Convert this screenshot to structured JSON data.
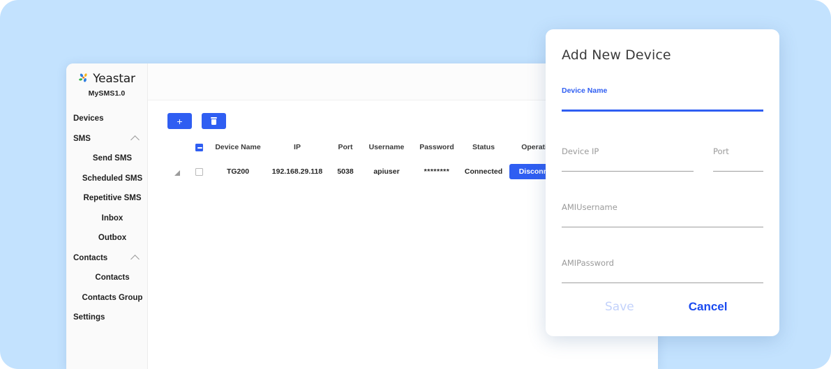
{
  "theme": {
    "page_background": "#c3e2fe",
    "accent_blue": "#2f5ef2",
    "link_blue": "#1a4af0",
    "status_green": "#16a34a",
    "disabled_blue": "#c3d2fb"
  },
  "sidebar": {
    "brand_name": "Yeastar",
    "brand_sub": "MySMS1.0",
    "logo_icon": "yeastar-flower-logo",
    "items": [
      {
        "label": "Devices",
        "type": "item"
      },
      {
        "label": "SMS",
        "type": "group",
        "icon": "chevron-up-icon"
      },
      {
        "label": "Send SMS",
        "type": "sub"
      },
      {
        "label": "Scheduled SMS",
        "type": "sub"
      },
      {
        "label": "Repetitive SMS",
        "type": "sub"
      },
      {
        "label": "Inbox",
        "type": "sub"
      },
      {
        "label": "Outbox",
        "type": "sub"
      },
      {
        "label": "Contacts",
        "type": "group",
        "icon": "chevron-up-icon"
      },
      {
        "label": "Contacts",
        "type": "sub"
      },
      {
        "label": "Contacts Group",
        "type": "sub"
      },
      {
        "label": "Settings",
        "type": "item"
      }
    ]
  },
  "toolbar": {
    "add_label": "+",
    "add_icon": "plus-icon",
    "delete_icon": "trash-icon"
  },
  "table": {
    "headers": [
      "",
      "",
      "Device Name",
      "IP",
      "Port",
      "Username",
      "Password",
      "Status",
      "Operation"
    ],
    "header_checkbox_state": "indeterminate",
    "rows": [
      {
        "device_name": "TG200",
        "ip": "192.168.29.118",
        "port": "5038",
        "username": "apiuser",
        "password": "********",
        "status": "Connected",
        "operation_label": "Disconnect",
        "checked": false
      }
    ]
  },
  "dialog": {
    "title": "Add New Device",
    "fields": {
      "device_name": {
        "label": "Device Name",
        "value": "",
        "focused": true
      },
      "device_ip": {
        "label": "Device IP",
        "value": "",
        "focused": false
      },
      "port": {
        "label": "Port",
        "value": "",
        "focused": false
      },
      "ami_username": {
        "label": "AMIUsername",
        "value": "",
        "focused": false
      },
      "ami_password": {
        "label": "AMIPassword",
        "value": "",
        "focused": false
      }
    },
    "save_label": "Save",
    "cancel_label": "Cancel",
    "save_enabled": false
  }
}
